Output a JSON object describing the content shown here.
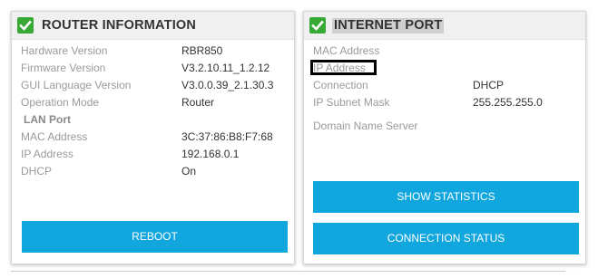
{
  "router_panel": {
    "title": "ROUTER INFORMATION",
    "rows": [
      {
        "label": "Hardware Version",
        "value": "RBR850"
      },
      {
        "label": "Firmware Version",
        "value": "V3.2.10.11_1.2.12"
      },
      {
        "label": "GUI Language Version",
        "value": "V3.0.0.39_2.1.30.3"
      },
      {
        "label": "Operation Mode",
        "value": "Router"
      }
    ],
    "lan_section_label": "LAN Port",
    "lan_rows": [
      {
        "label": "MAC Address",
        "value": "3C:37:86:B8:F7:68"
      },
      {
        "label": "IP Address",
        "value": "192.168.0.1"
      },
      {
        "label": "DHCP",
        "value": "On"
      }
    ],
    "reboot_label": "REBOOT"
  },
  "internet_panel": {
    "title": "INTERNET PORT",
    "rows": [
      {
        "label": "MAC Address",
        "value": ""
      },
      {
        "label": "IP Address",
        "value": ""
      },
      {
        "label": "Connection",
        "value": "DHCP"
      },
      {
        "label": "IP Subnet Mask",
        "value": "255.255.255.0"
      },
      {
        "label": "Domain Name Server",
        "value": ""
      }
    ],
    "show_statistics_label": "SHOW STATISTICS",
    "connection_status_label": "CONNECTION STATUS"
  },
  "colors": {
    "accent": "#11a6dd",
    "check_green": "#39a935",
    "header_bg": "#f0f0f0"
  },
  "icons": {
    "panel_status": "check-icon"
  }
}
